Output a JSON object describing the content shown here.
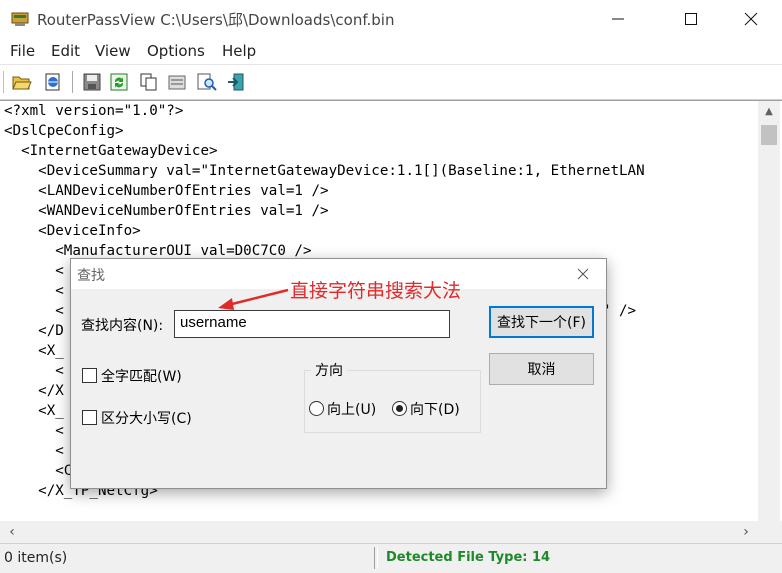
{
  "window": {
    "app_name": "RouterPassView",
    "title": "RouterPassView    C:\\Users\\邱\\Downloads\\conf.bin"
  },
  "menu": [
    "File",
    "Edit",
    "View",
    "Options",
    "Help"
  ],
  "code_lines": [
    "<?xml version=\"1.0\"?>",
    "<DslCpeConfig>",
    "  <InternetGatewayDevice>",
    "    <DeviceSummary val=\"InternetGatewayDevice:1.1[](Baseline:1, EthernetLAN",
    "    <LANDeviceNumberOfEntries val=1 />",
    "    <WANDeviceNumberOfEntries val=1 />",
    "    <DeviceInfo>",
    "      <ManufacturerOUI val=D0C7C0 />",
    "      <",
    "      <",
    "      <                                                      el.34994n\" />",
    "    </D",
    "    <X_",
    "      <",
    "    </X",
    "    <X_",
    "      <",
    "      <",
    "      <CurrDNSServer val=3395721219 />",
    "    </X_TP_NetCfg>"
  ],
  "status": {
    "items": "0 item(s)",
    "file_type": "Detected File Type: 14"
  },
  "dialog": {
    "title": "查找",
    "find_label": "查找内容(N):",
    "find_value": "username",
    "find_next_button": "查找下一个(F)",
    "cancel_button": "取消",
    "whole_word": "全字匹配(W)",
    "match_case": "区分大小写(C)",
    "direction_label": "方向",
    "direction_up": "向上(U)",
    "direction_down": "向下(D)",
    "direction_selected": "down"
  },
  "annotation": {
    "text": "直接字符串搜索大法",
    "color": "#e12a2a"
  },
  "icons": [
    "open-folder-icon",
    "report-icon",
    "save-icon",
    "refresh-icon",
    "copy-icon",
    "properties-icon",
    "find-icon",
    "exit-icon"
  ]
}
